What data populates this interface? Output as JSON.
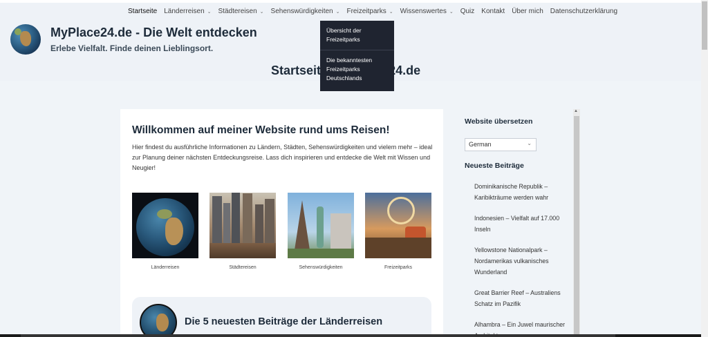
{
  "nav": {
    "items": [
      {
        "label": "Startseite",
        "dropdown": false,
        "active": true
      },
      {
        "label": "Länderreisen",
        "dropdown": true
      },
      {
        "label": "Städtereisen",
        "dropdown": true
      },
      {
        "label": "Sehenswürdigkeiten",
        "dropdown": true
      },
      {
        "label": "Freizeitparks",
        "dropdown": true
      },
      {
        "label": "Wissenswertes",
        "dropdown": true
      },
      {
        "label": "Quiz",
        "dropdown": false
      },
      {
        "label": "Kontakt",
        "dropdown": false
      },
      {
        "label": "Über mich",
        "dropdown": false
      },
      {
        "label": "Datenschutzerklärung",
        "dropdown": false
      }
    ],
    "dropdown_open": {
      "parent": "Freizeitparks",
      "items": [
        "Übersicht der Freizeitparks",
        "Die bekanntesten Freizeitparks Deutschlands"
      ]
    }
  },
  "header": {
    "site_title": "MyPlace24.de - Die Welt entdecken",
    "tagline": "Erlebe Vielfalt. Finde deinen Lieblingsort.",
    "page_heading": "Startseite - MyPlace24.de"
  },
  "main": {
    "title": "Willkommen auf meiner Website rund ums Reisen!",
    "intro": "Hier findest du ausführliche Informationen zu Ländern, Städten, Sehenswürdigkeiten und vielem mehr – ideal zur Planung deiner nächsten Entdeckungsreise. Lass dich inspirieren und entdecke die Welt mit Wissen und Neugier!",
    "tiles": [
      {
        "caption": "Länderreisen",
        "icon": "globe-image"
      },
      {
        "caption": "Städtereisen",
        "icon": "city-street-image"
      },
      {
        "caption": "Sehenswürdigkeiten",
        "icon": "landmarks-image"
      },
      {
        "caption": "Freizeitparks",
        "icon": "amusement-park-image"
      }
    ],
    "latest_title": "Die 5 neuesten Beiträge der Länderreisen"
  },
  "sidebar": {
    "translate_heading": "Website übersetzen",
    "language_selected": "German",
    "latest_heading": "Neueste Beiträge",
    "posts": [
      "Dominikanische Republik – Karibikträume werden wahr",
      "Indonesien – Vielfalt auf 17.000 Inseln",
      "Yellowstone Nationalpark – Nordamerikas vulkanisches Wunderland",
      "Great Barrier Reef – Australiens Schatz im Pazifik",
      "Alhambra – Ein Juwel maurischer Architektur"
    ]
  }
}
